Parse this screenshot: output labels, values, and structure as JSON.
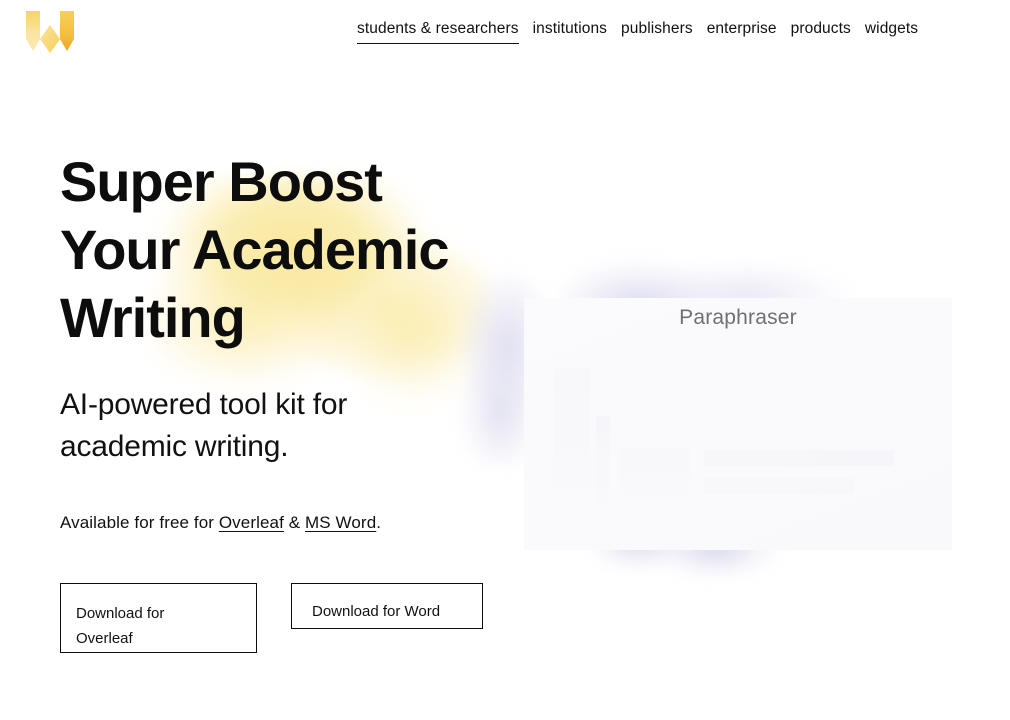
{
  "brand": {
    "logo_name": "writefull-w-logo",
    "logo_colors": [
      "#F7D66B",
      "#FAE39A",
      "#F5C24A",
      "#F0A92A",
      "#FBE7A8"
    ]
  },
  "header": {
    "nav": [
      {
        "label": "students & researchers",
        "active": true
      },
      {
        "label": "institutions",
        "active": false
      },
      {
        "label": "publishers",
        "active": false
      },
      {
        "label": "enterprise",
        "active": false
      },
      {
        "label": "products",
        "active": false
      },
      {
        "label": "widgets",
        "active": false
      }
    ]
  },
  "hero": {
    "title": "Super Boost\nYour Academic\nWriting",
    "subtitle": "AI-powered tool kit for\nacademic writing.",
    "availability": {
      "prefix": "Available for free for ",
      "link_one": "Overleaf",
      "separator": " & ",
      "link_two": "MS Word",
      "suffix": "."
    },
    "buttons": [
      {
        "label": "Download for\nOverleaf",
        "name": "download-overleaf-button"
      },
      {
        "label": "Download for Word",
        "name": "download-word-button"
      }
    ]
  },
  "preview": {
    "card_title": "Paraphraser"
  },
  "colors": {
    "accent_yellow": "#FAEAA5",
    "accent_purple": "#CECCE7",
    "text": "#111111",
    "muted_text": "#6F7076",
    "background": "#FFFFFF"
  }
}
